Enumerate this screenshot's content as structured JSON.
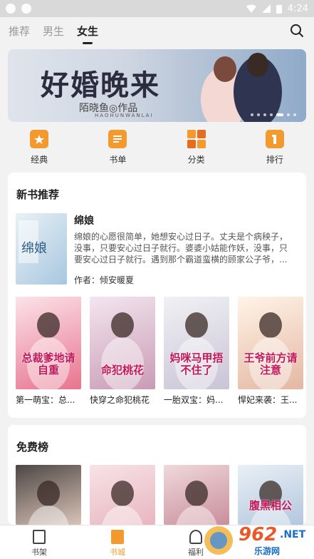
{
  "status_bar": {
    "time": "4:24"
  },
  "top_tabs": [
    {
      "label": "推荐",
      "active": false
    },
    {
      "label": "男生",
      "active": false
    },
    {
      "label": "女生",
      "active": true
    }
  ],
  "banner": {
    "title": "好婚晚来",
    "author": "陌晓鱼◎作品",
    "subtitle": "HAOHUNWANLAI"
  },
  "categories": [
    {
      "label": "经典",
      "icon": "classic-icon"
    },
    {
      "label": "书单",
      "icon": "booklist-icon"
    },
    {
      "label": "分类",
      "icon": "category-icon"
    },
    {
      "label": "排行",
      "icon": "ranking-icon"
    }
  ],
  "new_books": {
    "section_title": "新书推荐",
    "featured": {
      "title": "绵娘",
      "description": "绵娘的心愿很简单，她想安心过日子。丈夫是个病秧子，没事，只要安心过日子就行。婆婆小姑能作妖，没事，只要安心过日子就行。遇到那个霸道蛮横的顾家公子爷，...",
      "author": "作者：倾安暖夏",
      "cover_text": "绵娘"
    },
    "books": [
      {
        "title": "第一萌宝：总...",
        "cover_text": "总裁爹地请自重",
        "color1": "#fbe3ea",
        "color2": "#e8748e"
      },
      {
        "title": "快穿之命犯桃花",
        "cover_text": "命犯桃花",
        "color1": "#f3e6ef",
        "color2": "#c99bb5"
      },
      {
        "title": "一胎双宝：妈...",
        "cover_text": "妈咪马甲捂不住了",
        "color1": "#f1f1f4",
        "color2": "#c9c4d6"
      },
      {
        "title": "悍妃来袭：王...",
        "cover_text": "王爷前方请注意",
        "color1": "#fff4e8",
        "color2": "#e4b7a2"
      }
    ]
  },
  "free_ranking": {
    "section_title": "免费榜",
    "books": [
      {
        "color1": "#4d4644",
        "color2": "#d9c3b7"
      },
      {
        "color1": "#f7e3e6",
        "color2": "#e8b6c0"
      },
      {
        "color1": "#efd9db",
        "color2": "#c98e9b"
      },
      {
        "color1": "#e9f0f6",
        "color2": "#b3c7de",
        "cover_text": "腹黑相公"
      }
    ]
  },
  "bottom_nav": [
    {
      "label": "书架",
      "active": false
    },
    {
      "label": "书城",
      "active": true
    },
    {
      "label": "福利",
      "active": false
    }
  ],
  "watermark": {
    "number": "962",
    "net": ".NET",
    "cn": "乐游网"
  }
}
